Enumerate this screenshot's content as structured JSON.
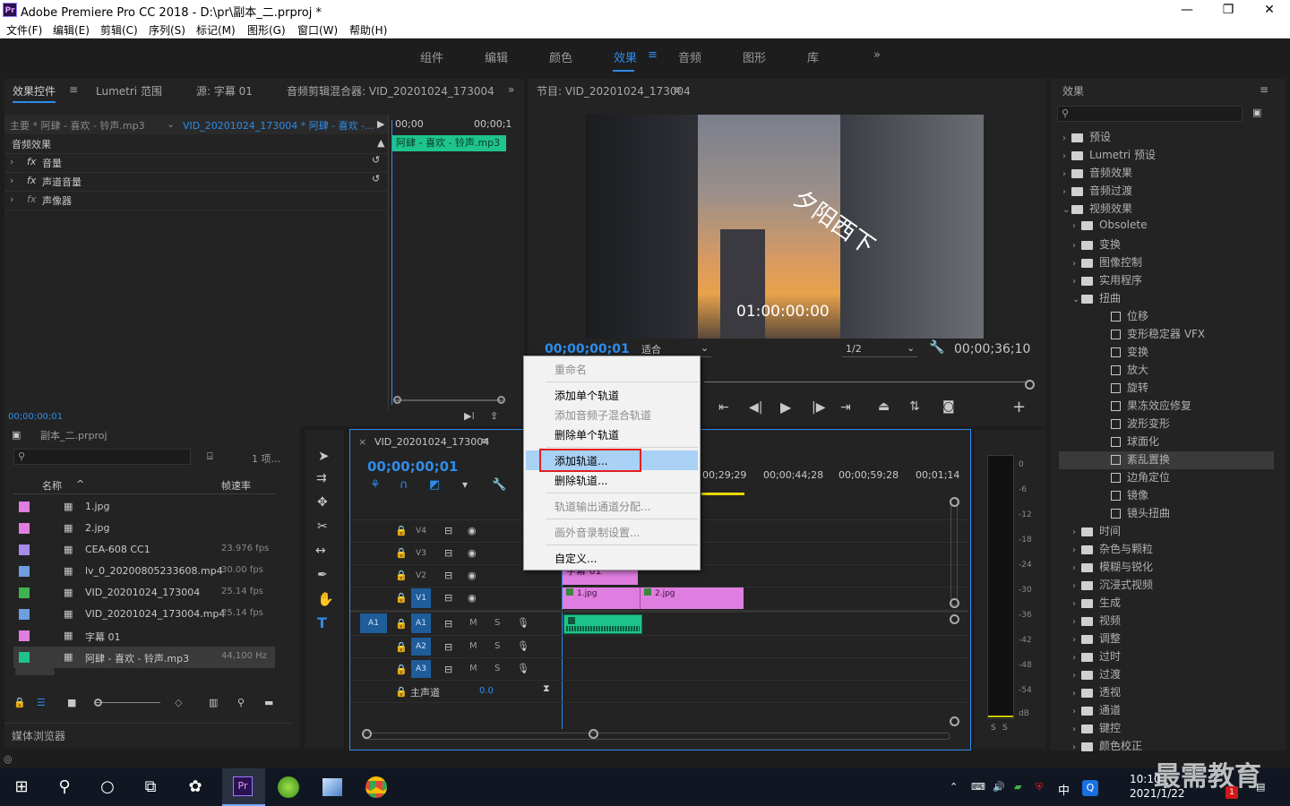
{
  "window": {
    "title": "Adobe Premiere Pro CC 2018 - D:\\pr\\副本_二.prproj *",
    "minimize": "—",
    "maximize": "❐",
    "close": "✕",
    "app_icon": "Pr"
  },
  "menu": [
    "文件(F)",
    "编辑(E)",
    "剪辑(C)",
    "序列(S)",
    "标记(M)",
    "图形(G)",
    "窗口(W)",
    "帮助(H)"
  ],
  "workspaces": {
    "tabs": [
      "组件",
      "编辑",
      "颜色",
      "效果",
      "音频",
      "图形",
      "库"
    ],
    "active": "效果",
    "more": "»"
  },
  "effect_controls": {
    "tabs": [
      "效果控件",
      "Lumetri 范围",
      "源: 字幕 01",
      "音频剪辑混合器: VID_20201024_173004"
    ],
    "master_label": "主要 * 阿肆 - 喜欢 - 铃声.mp3",
    "seq_label": "VID_20201024_173004 * 阿肆 - 喜欢 -...",
    "section": "音频效果",
    "items": [
      "音量",
      "声道音量",
      "声像器"
    ],
    "time_start": "00;00",
    "time_end": "00;00;1",
    "clip_name": "阿肆 - 喜欢 - 铃声.mp3",
    "timecode": "00;00;00;01"
  },
  "program": {
    "title": "节目: VID_20201024_173004",
    "overlay_text": "夕阳西下",
    "overlay_timecode": "01:00:00:00",
    "timecode": "00;00;00;01",
    "fit": "适合",
    "quality": "1/2",
    "duration": "00;00;36;10"
  },
  "project": {
    "name": "副本_二.prproj",
    "count": "1 项...",
    "col_name": "名称",
    "col_fps": "帧速率",
    "items": [
      {
        "color": "#e07de0",
        "name": "1.jpg",
        "fps": ""
      },
      {
        "color": "#e07de0",
        "name": "2.jpg",
        "fps": ""
      },
      {
        "color": "#a78be8",
        "name": "CEA-608 CC1",
        "fps": "23.976 fps"
      },
      {
        "color": "#6d9ee0",
        "name": "lv_0_20200805233608.mp4",
        "fps": "30.00 fps"
      },
      {
        "color": "#3fb34f",
        "name": "VID_20201024_173004",
        "fps": "25.14 fps"
      },
      {
        "color": "#6d9ee0",
        "name": "VID_20201024_173004.mp4",
        "fps": "25.14 fps"
      },
      {
        "color": "#e07de0",
        "name": "字幕 01",
        "fps": ""
      },
      {
        "color": "#1fc38c",
        "name": "阿肆 - 喜欢 - 铃声.mp3",
        "fps": "44,100 Hz"
      }
    ],
    "media_browser": "媒体浏览器"
  },
  "timeline": {
    "tab": "VID_20201024_173004",
    "timecode": "00;00;00;01",
    "ruler": [
      "00;29;29",
      "00;00;44;28",
      "00;00;59;28",
      "00;01;14"
    ],
    "video_tracks": [
      "V4",
      "V3",
      "V2",
      "V1"
    ],
    "audio_tracks": [
      "A1",
      "A2",
      "A3"
    ],
    "master": "主声道",
    "master_value": "0.0",
    "clips": {
      "v1_a": "1.jpg",
      "v1_b": "2.jpg",
      "v2": "字幕 01",
      "a1_src": "A1"
    },
    "track_m": "M",
    "track_s": "S"
  },
  "context_menu": {
    "items": [
      "重命名",
      "添加单个轨道",
      "添加音频子混合轨道",
      "删除单个轨道",
      "添加轨道...",
      "删除轨道...",
      "轨道输出通道分配...",
      "画外音录制设置...",
      "自定义..."
    ],
    "highlight": "添加轨道..."
  },
  "effects": {
    "title": "效果",
    "items": [
      {
        "depth": 0,
        "kind": "folder",
        "open": false,
        "label": "预设"
      },
      {
        "depth": 0,
        "kind": "folder",
        "open": false,
        "label": "Lumetri 预设"
      },
      {
        "depth": 0,
        "kind": "folder",
        "open": false,
        "label": "音频效果"
      },
      {
        "depth": 0,
        "kind": "folder",
        "open": false,
        "label": "音频过渡"
      },
      {
        "depth": 0,
        "kind": "folder",
        "open": true,
        "label": "视频效果"
      },
      {
        "depth": 1,
        "kind": "folder",
        "open": false,
        "label": "Obsolete"
      },
      {
        "depth": 1,
        "kind": "folder",
        "open": false,
        "label": "变换"
      },
      {
        "depth": 1,
        "kind": "folder",
        "open": false,
        "label": "图像控制"
      },
      {
        "depth": 1,
        "kind": "folder",
        "open": false,
        "label": "实用程序"
      },
      {
        "depth": 1,
        "kind": "folder",
        "open": true,
        "label": "扭曲"
      },
      {
        "depth": 2,
        "kind": "fx",
        "label": "位移"
      },
      {
        "depth": 2,
        "kind": "fx",
        "label": "变形稳定器 VFX"
      },
      {
        "depth": 2,
        "kind": "fx",
        "label": "变换"
      },
      {
        "depth": 2,
        "kind": "fx",
        "label": "放大"
      },
      {
        "depth": 2,
        "kind": "fx",
        "label": "旋转"
      },
      {
        "depth": 2,
        "kind": "fx",
        "label": "果冻效应修复"
      },
      {
        "depth": 2,
        "kind": "fx",
        "label": "波形变形"
      },
      {
        "depth": 2,
        "kind": "fx",
        "label": "球面化"
      },
      {
        "depth": 2,
        "kind": "fx",
        "label": "紊乱置换",
        "selected": true
      },
      {
        "depth": 2,
        "kind": "fx",
        "label": "边角定位"
      },
      {
        "depth": 2,
        "kind": "fx",
        "label": "镜像"
      },
      {
        "depth": 2,
        "kind": "fx",
        "label": "镜头扭曲"
      },
      {
        "depth": 1,
        "kind": "folder",
        "open": false,
        "label": "时间"
      },
      {
        "depth": 1,
        "kind": "folder",
        "open": false,
        "label": "杂色与颗粒"
      },
      {
        "depth": 1,
        "kind": "folder",
        "open": false,
        "label": "模糊与锐化"
      },
      {
        "depth": 1,
        "kind": "folder",
        "open": false,
        "label": "沉浸式视频"
      },
      {
        "depth": 1,
        "kind": "folder",
        "open": false,
        "label": "生成"
      },
      {
        "depth": 1,
        "kind": "folder",
        "open": false,
        "label": "视频"
      },
      {
        "depth": 1,
        "kind": "folder",
        "open": false,
        "label": "调整"
      },
      {
        "depth": 1,
        "kind": "folder",
        "open": false,
        "label": "过时"
      },
      {
        "depth": 1,
        "kind": "folder",
        "open": false,
        "label": "过渡"
      },
      {
        "depth": 1,
        "kind": "folder",
        "open": false,
        "label": "透视"
      },
      {
        "depth": 1,
        "kind": "folder",
        "open": false,
        "label": "通道"
      },
      {
        "depth": 1,
        "kind": "folder",
        "open": false,
        "label": "键控"
      },
      {
        "depth": 1,
        "kind": "folder",
        "open": false,
        "label": "颜色校正"
      }
    ]
  },
  "vu_meter": {
    "labels": [
      "0",
      "-6",
      "-12",
      "-18",
      "-24",
      "-30",
      "-36",
      "-42",
      "-48",
      "-54",
      "dB"
    ],
    "solo": "S"
  },
  "taskbar": {
    "time": "10:10",
    "date": "2021/1/22",
    "ime": "中",
    "watermark": "最需教育",
    "notif": "1"
  }
}
